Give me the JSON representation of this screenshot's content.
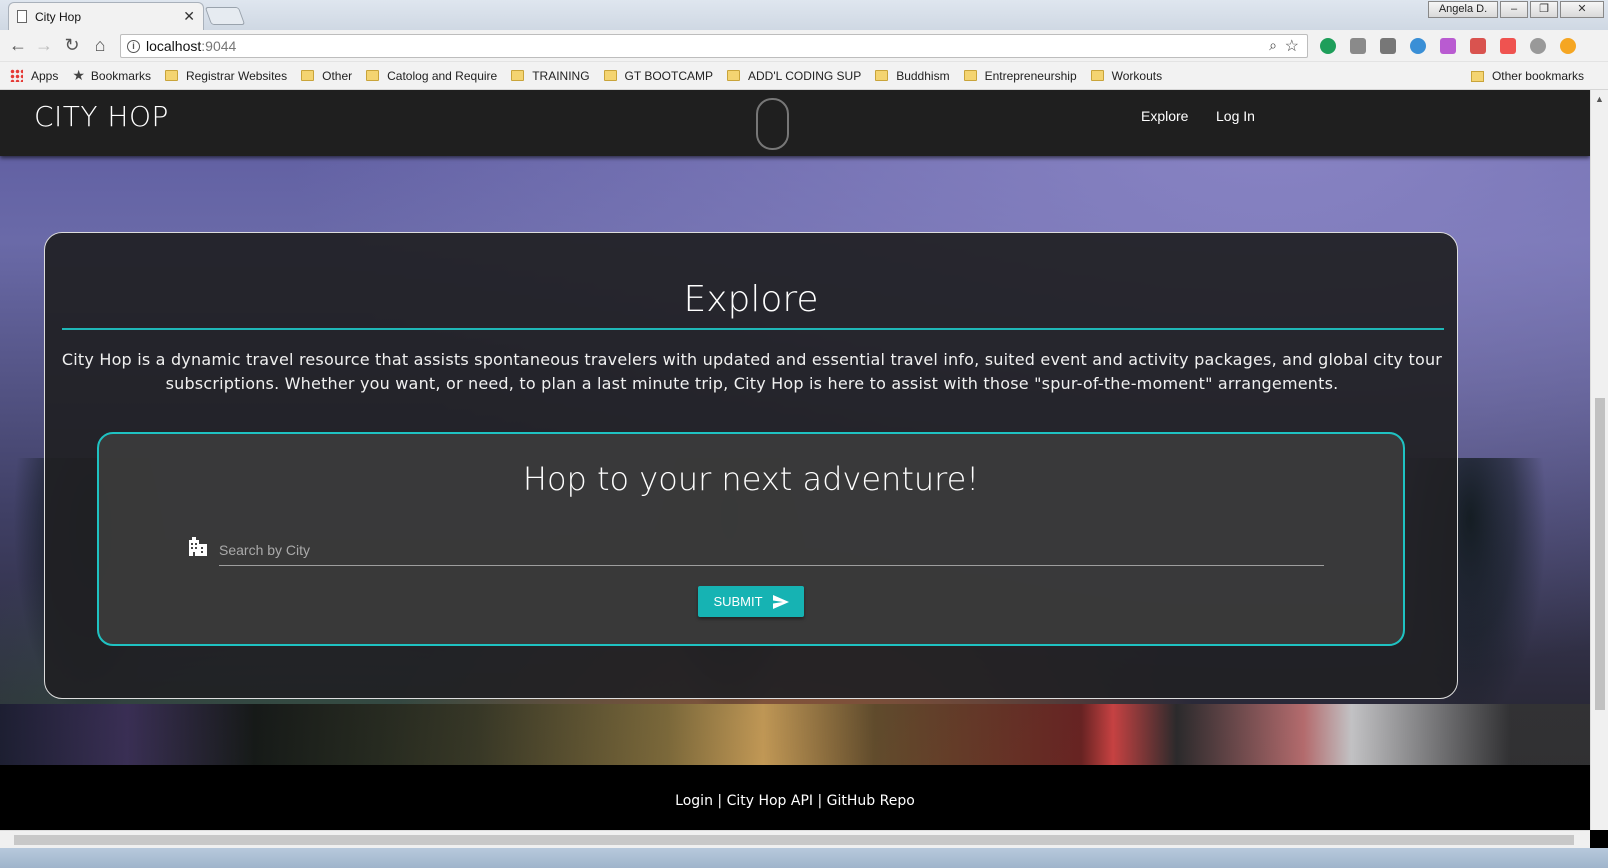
{
  "browser": {
    "tab_title": "City Hop",
    "tab_close": "✕",
    "user_name": "Angela D.",
    "window_controls": [
      "–",
      "❐",
      "✕"
    ],
    "url_host": "localhost",
    "url_port": ":9044",
    "nav_icons": [
      "back-icon",
      "forward-icon",
      "reload-icon",
      "home-icon"
    ],
    "bookmarks": [
      {
        "label": "Apps",
        "icon": "apps-icon"
      },
      {
        "label": "Bookmarks",
        "icon": "star-icon"
      },
      {
        "label": "Registrar Websites",
        "icon": "folder-icon"
      },
      {
        "label": "Other",
        "icon": "folder-icon"
      },
      {
        "label": "Catolog and Require",
        "icon": "folder-icon"
      },
      {
        "label": "TRAINING",
        "icon": "folder-icon"
      },
      {
        "label": "GT BOOTCAMP",
        "icon": "folder-icon"
      },
      {
        "label": "ADD'L CODING SUP",
        "icon": "folder-icon"
      },
      {
        "label": "Buddhism",
        "icon": "folder-icon"
      },
      {
        "label": "Entrepreneurship",
        "icon": "folder-icon"
      },
      {
        "label": "Workouts",
        "icon": "folder-icon"
      }
    ],
    "other_bookmarks": "Other bookmarks",
    "extension_colors": [
      "#1e9e5a",
      "#8a8a8a",
      "#777777",
      "#3a8fd6",
      "#b95bd1",
      "#d9534f",
      "#ef5350",
      "#999999",
      "#f5a623"
    ]
  },
  "navbar": {
    "brand": "CITY HOP",
    "links": [
      "Explore",
      "Log In"
    ]
  },
  "explore": {
    "title": "Explore",
    "description": "City Hop is a dynamic travel resource that assists spontaneous travelers with updated and essential travel info, suited event and activity packages, and global city tour subscriptions. Whether you want, or need, to plan a last minute trip, City Hop is here to assist with those \"spur-of-the-moment\" arrangements."
  },
  "search": {
    "title": "Hop to your next adventure!",
    "placeholder": "Search by City",
    "value": "",
    "submit_label": "SUBMIT"
  },
  "footer": {
    "links": [
      "Login",
      "City Hop API",
      "GitHub Repo"
    ],
    "separator": " | "
  },
  "colors": {
    "accent_teal": "#1fb7b7",
    "navbar_bg": "#1f1f1f",
    "footer_bg": "#000000"
  }
}
